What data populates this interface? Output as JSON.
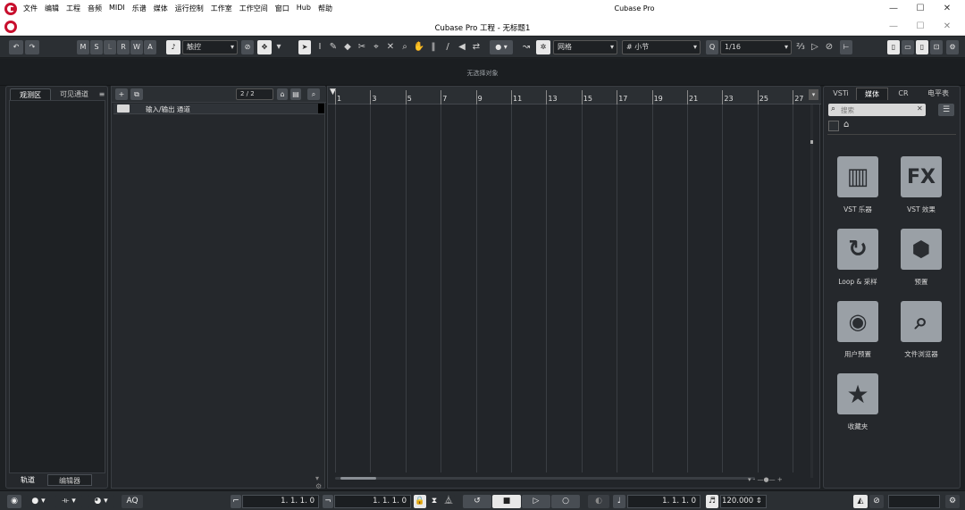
{
  "menubar": {
    "items": [
      "文件",
      "编辑",
      "工程",
      "音频",
      "MIDI",
      "乐谱",
      "媒体",
      "运行控制",
      "工作室",
      "工作空间",
      "窗口",
      "Hub",
      "帮助"
    ],
    "app_title": "Cubase Pro",
    "minimize": "—",
    "maximize": "☐",
    "close": "✕"
  },
  "docbar": {
    "title": "Cubase Pro 工程 - 无标题1",
    "minimize": "—",
    "maximize": "☐",
    "close": "✕"
  },
  "toolbar": {
    "undo": "↶",
    "redo": "↷",
    "buttons": [
      "M",
      "S",
      "L",
      "R",
      "W",
      "A"
    ],
    "automation_mode": "触控",
    "snap_type": "网格",
    "grid_type": "小节",
    "quantize_value": "1/16"
  },
  "info_line": {
    "no_selection": "无选择对象"
  },
  "left_zone": {
    "tabs": [
      "观测区",
      "可见通道"
    ],
    "bottom_tabs": [
      "轨道",
      "编辑器"
    ]
  },
  "track_list": {
    "counter": "2 / 2",
    "tracks": [
      {
        "name": "输入/输出 通道"
      }
    ]
  },
  "ruler": {
    "bars": [
      "1",
      "3",
      "5",
      "7",
      "9",
      "11",
      "13",
      "15",
      "17",
      "19",
      "21",
      "23",
      "25",
      "27"
    ]
  },
  "right_zone": {
    "tabs": [
      "VSTi",
      "媒体",
      "CR",
      "电平表"
    ],
    "search_placeholder": "搜索",
    "tiles": [
      {
        "icon": "piano-keys-icon",
        "glyph": "▥",
        "label": "VST 乐器"
      },
      {
        "icon": "fx-icon",
        "glyph": "FX",
        "label": "VST 效果"
      },
      {
        "icon": "loop-icon",
        "glyph": "↻",
        "label": "Loop & 采样"
      },
      {
        "icon": "presets-icon",
        "glyph": "⬢",
        "label": "预置"
      },
      {
        "icon": "user-presets-icon",
        "glyph": "◉",
        "label": "用户预置"
      },
      {
        "icon": "file-browser-icon",
        "glyph": "⌕",
        "label": "文件浏览器"
      },
      {
        "icon": "favorites-icon",
        "glyph": "★",
        "label": "收藏夹"
      }
    ]
  },
  "transport": {
    "aq": "AQ",
    "left_locator": "1. 1. 1.   0",
    "right_locator": "1. 1. 1.   0",
    "primary_time": "1. 1. 1.   0",
    "tempo": "120.000"
  },
  "colors": {
    "brand_red": "#c8102e",
    "background": "#1e2124",
    "tile_gray": "#9aa0a6"
  }
}
